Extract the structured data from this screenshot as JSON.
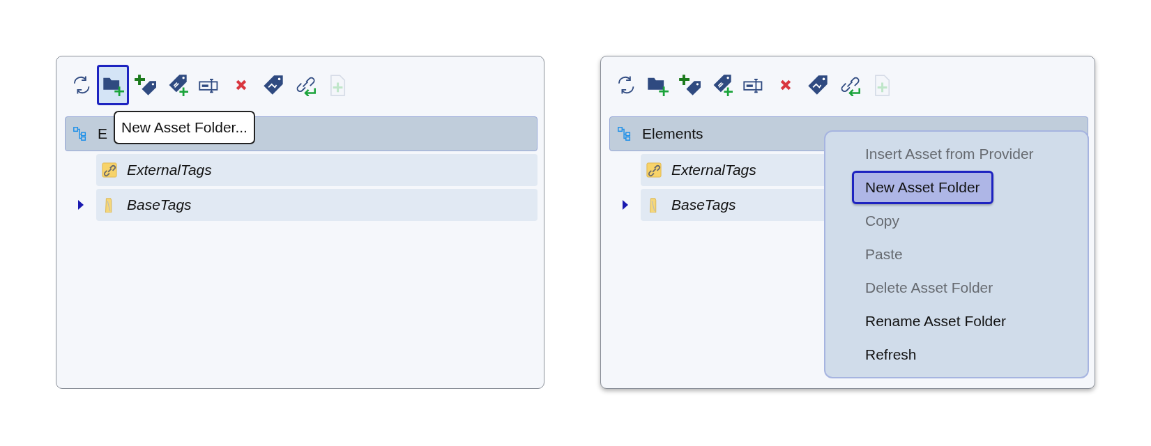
{
  "panels": [
    {
      "raised": false,
      "toolbar": [
        {
          "kind": "refresh",
          "focused": false,
          "disabled": false
        },
        {
          "kind": "new-folder",
          "focused": true,
          "disabled": false
        },
        {
          "kind": "new-tag",
          "focused": false,
          "disabled": false
        },
        {
          "kind": "new-linked-tag",
          "focused": false,
          "disabled": false
        },
        {
          "kind": "rename",
          "focused": false,
          "disabled": false
        },
        {
          "kind": "delete",
          "focused": false,
          "disabled": false
        },
        {
          "kind": "tag-move",
          "focused": false,
          "disabled": false
        },
        {
          "kind": "link-return",
          "focused": false,
          "disabled": false
        },
        {
          "kind": "new-document",
          "focused": false,
          "disabled": true
        }
      ],
      "tree": {
        "label": "E",
        "kind": "elements",
        "selected": true,
        "children": [
          {
            "label": "ExternalTags",
            "kind": "link-folder",
            "selected": false
          },
          {
            "label": "BaseTags",
            "kind": "folder",
            "selected": false,
            "expanded": false
          }
        ]
      },
      "tooltip": {
        "text": "New Asset Folder..."
      }
    },
    {
      "raised": true,
      "toolbar": [
        {
          "kind": "refresh",
          "focused": false,
          "disabled": false
        },
        {
          "kind": "new-folder",
          "focused": false,
          "disabled": false
        },
        {
          "kind": "new-tag",
          "focused": false,
          "disabled": false
        },
        {
          "kind": "new-linked-tag",
          "focused": false,
          "disabled": false
        },
        {
          "kind": "rename",
          "focused": false,
          "disabled": false
        },
        {
          "kind": "delete",
          "focused": false,
          "disabled": false
        },
        {
          "kind": "tag-move",
          "focused": false,
          "disabled": false
        },
        {
          "kind": "link-return",
          "focused": false,
          "disabled": false
        },
        {
          "kind": "new-document",
          "focused": false,
          "disabled": true
        }
      ],
      "tree": {
        "label": "Elements",
        "kind": "elements",
        "selected": true,
        "children": [
          {
            "label": "ExternalTags",
            "kind": "link-folder",
            "selected": false
          },
          {
            "label": "BaseTags",
            "kind": "folder",
            "selected": false,
            "expanded": false
          }
        ]
      },
      "context_menu": {
        "items": [
          {
            "label": "Insert Asset from Provider",
            "disabled": true,
            "selected": false
          },
          {
            "label": "New Asset Folder",
            "disabled": false,
            "selected": true
          },
          {
            "label": "Copy",
            "disabled": true,
            "selected": false
          },
          {
            "label": "Paste",
            "disabled": true,
            "selected": false
          },
          {
            "label": "Delete Asset Folder",
            "disabled": true,
            "selected": false
          },
          {
            "label": "Rename Asset Folder",
            "disabled": false,
            "selected": false
          },
          {
            "label": "Refresh",
            "disabled": false,
            "selected": false
          }
        ]
      }
    }
  ]
}
